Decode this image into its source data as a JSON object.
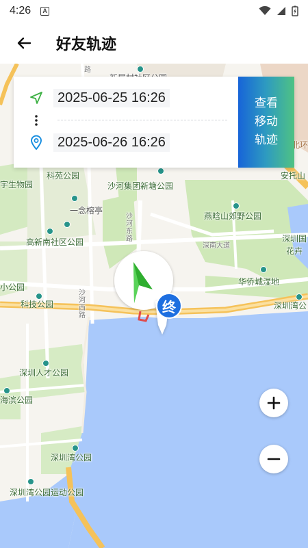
{
  "status": {
    "time": "4:26",
    "a_badge": "A"
  },
  "header": {
    "title": "好友轨迹"
  },
  "card": {
    "start_time": "2025-06-25 16:26",
    "end_time": "2025-06-26 16:26",
    "view_button": "查看移动轨迹"
  },
  "marker": {
    "end_label": "终"
  },
  "map": {
    "labels": {
      "l1": "宇生物园",
      "l2": "科苑公园",
      "l3": "沙河集团新塘公园",
      "l4": "安托山",
      "l5": "一念榕亭",
      "l6": "燕晗山郊野公园",
      "l7": "沙河东路",
      "l8": "高新南社区公园",
      "l9": "深南大道",
      "l10": "深圳国",
      "l11": "花卉",
      "l12": "华侨城湿地",
      "l13": "小公园",
      "l14": "科技公园",
      "l15": "沙河西路",
      "l16": "深圳湾公",
      "l17": "深圳人才公园",
      "l18": "海滨公园",
      "l19": "深圳湾公园",
      "l20": "深圳湾公园运动公园",
      "l21": "北环",
      "l22": "新屋村社区公园",
      "l23": "路"
    }
  },
  "colors": {
    "accent": "#1e6fe0",
    "marker_green": "#2fae2f",
    "water": "#a9c9fb",
    "park": "#cfe8b8",
    "road_major": "#f5c25a"
  }
}
